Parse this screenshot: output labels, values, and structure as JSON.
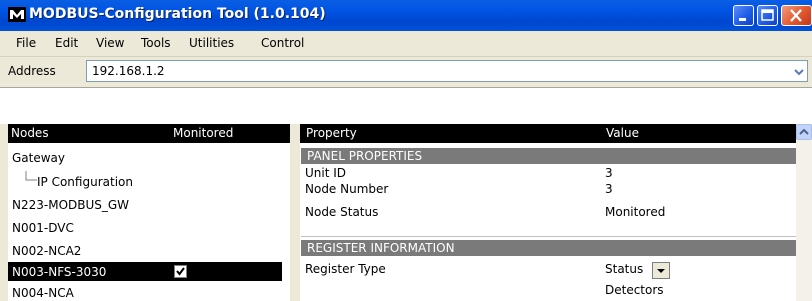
{
  "window": {
    "title": "MODBUS-Configuration Tool (1.0.104)",
    "app_icon": "modbus-logo-icon",
    "title_bar_color": "#0054e3"
  },
  "menu": [
    {
      "label": "File"
    },
    {
      "label": "Edit"
    },
    {
      "label": "View"
    },
    {
      "label": "Tools"
    },
    {
      "label": "Utilities"
    },
    {
      "label": "Control"
    }
  ],
  "address": {
    "label": "Address",
    "value": "192.168.1.2"
  },
  "nodes_panel": {
    "header_nodes": "Nodes",
    "header_monitored": "Monitored",
    "items": [
      {
        "label": "Gateway"
      },
      {
        "label": "IP Configuration"
      },
      {
        "label": "N223-MODBUS_GW"
      },
      {
        "label": "N001-DVC"
      },
      {
        "label": "N002-NCA2"
      },
      {
        "label": "N003-NFS-3030",
        "selected": true,
        "monitored": true
      },
      {
        "label": "N004-NCA"
      }
    ]
  },
  "properties_panel": {
    "header_property": "Property",
    "header_value": "Value",
    "sections": [
      {
        "title": "PANEL PROPERTIES",
        "rows": [
          {
            "property": "Unit ID",
            "value": "3"
          },
          {
            "property": "Node Number",
            "value": "3"
          },
          {
            "property": "Node Status",
            "value": "Monitored"
          }
        ]
      },
      {
        "title": "REGISTER INFORMATION",
        "rows": [
          {
            "property": "Register Type",
            "value": "Status"
          },
          {
            "property": "",
            "value": "Detectors"
          }
        ]
      }
    ]
  }
}
